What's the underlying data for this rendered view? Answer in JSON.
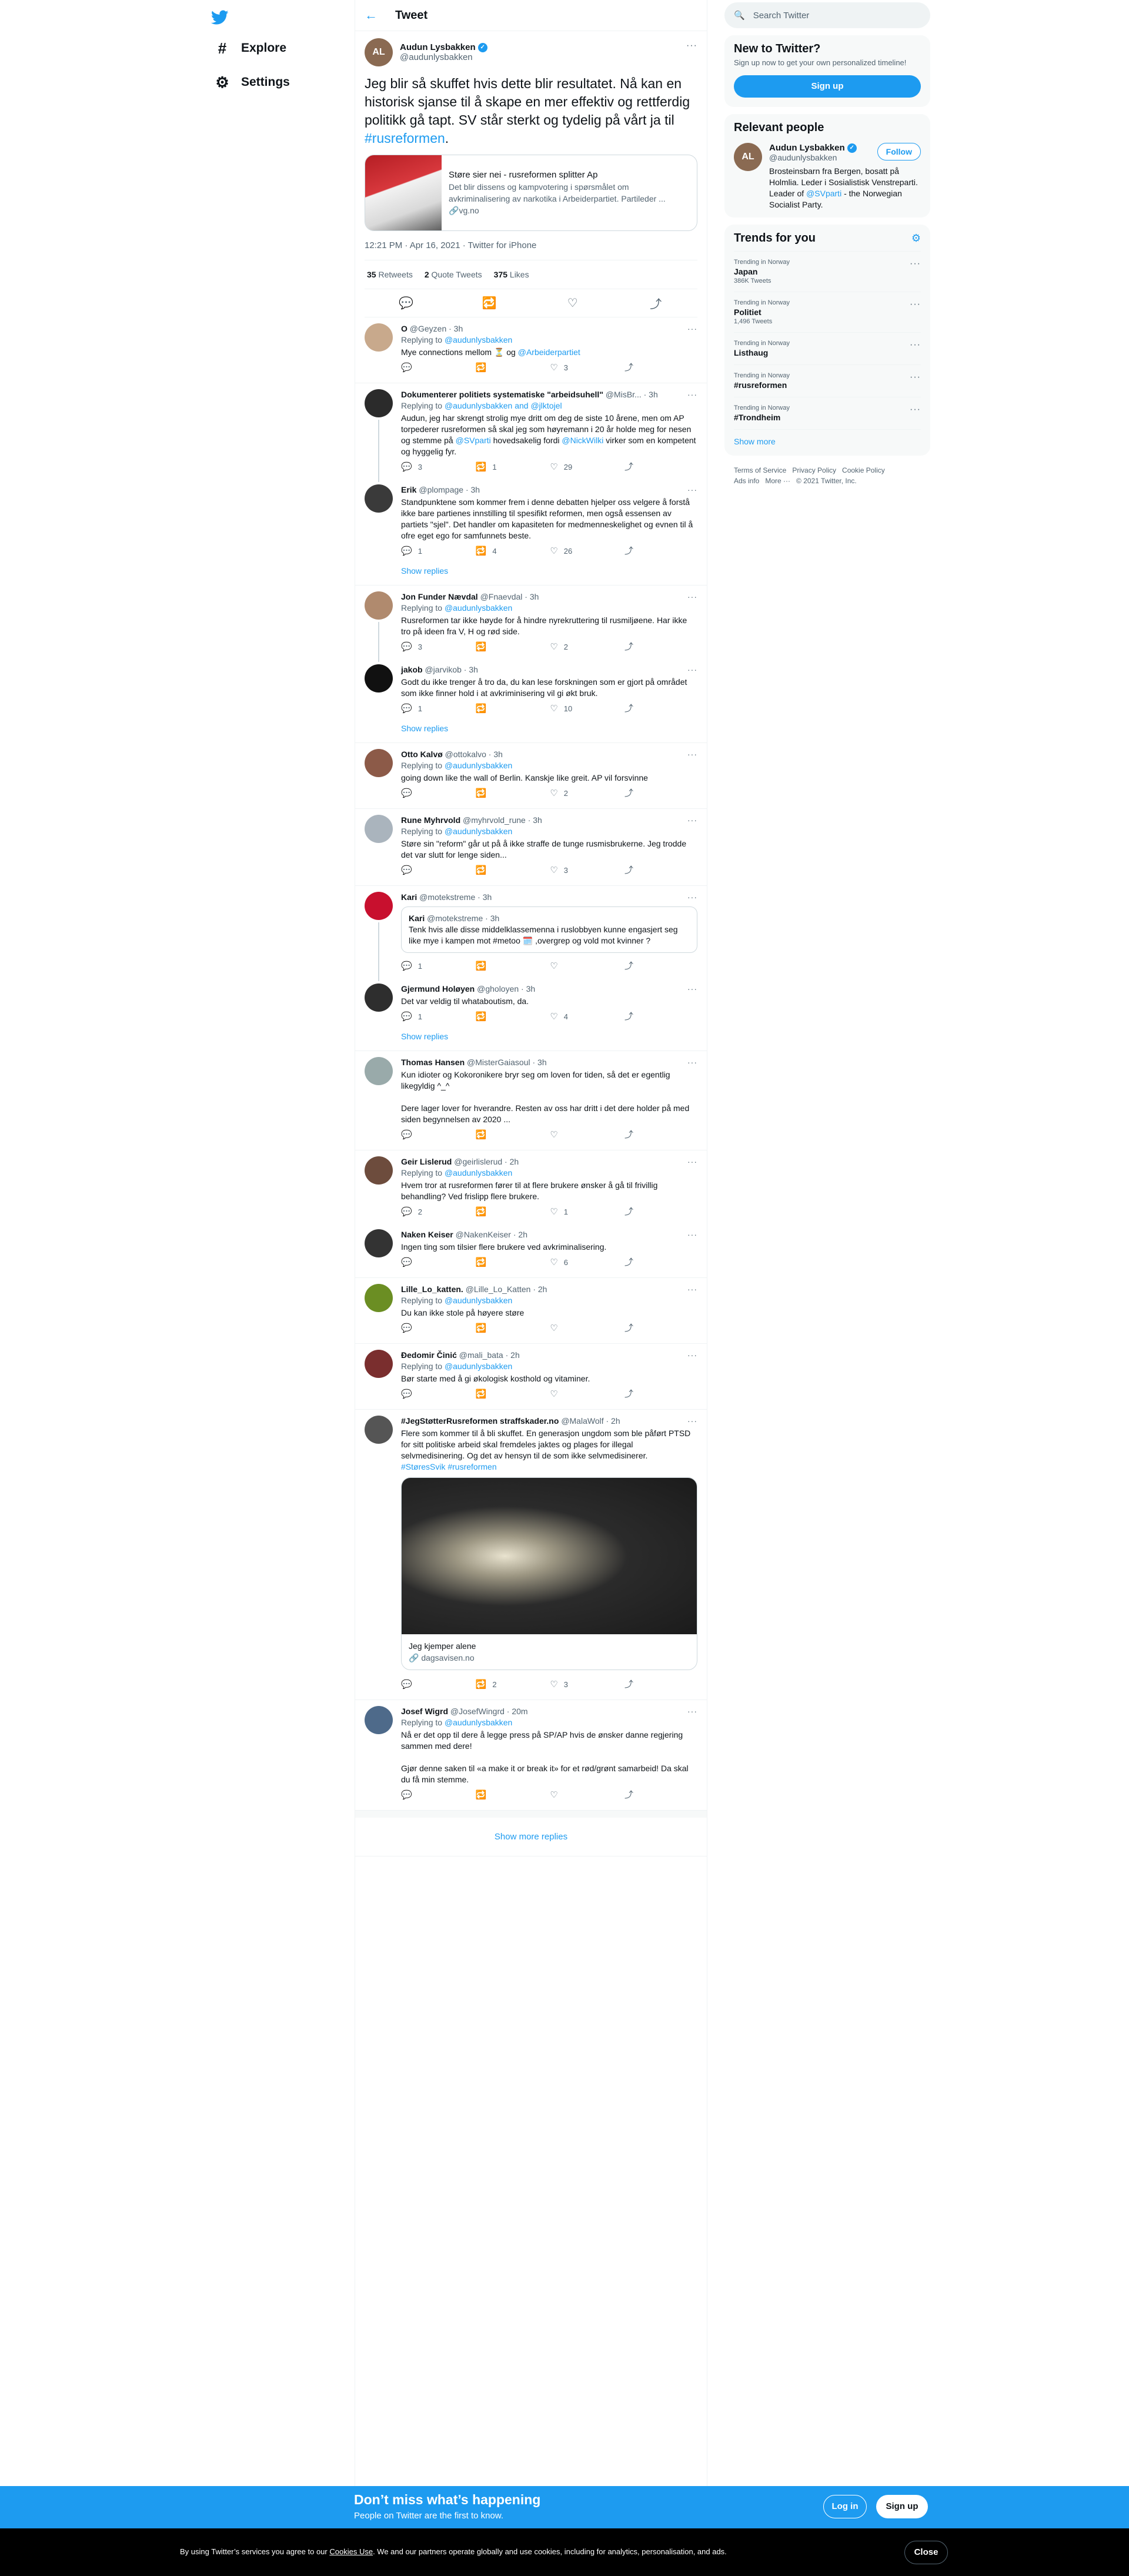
{
  "nav": {
    "items": [
      {
        "label": "Explore",
        "icon": "hashtag-icon"
      },
      {
        "label": "Settings",
        "icon": "gear-icon"
      }
    ]
  },
  "header": {
    "title": "Tweet"
  },
  "tweet": {
    "author_name": "Audun Lysbakken",
    "author_handle": "@audunlysbakken",
    "text_pre": "Jeg blir så skuffet hvis dette blir resultatet. Nå kan en historisk sjanse til å skape en mer effektiv og rettferdig politikk gå tapt. SV står sterkt og tydelig på vårt ja til ",
    "hashtag": "#rusreformen",
    "text_post": ".",
    "card_title": "Støre sier nei - rusreformen splitter Ap",
    "card_desc": "Det blir dissens og kampvotering i spørsmålet om avkriminalisering av narkotika i Arbeiderpartiet. Partileder ...",
    "card_domain": "vg.no",
    "time": "12:21 PM · Apr 16, 2021 · Twitter for iPhone",
    "retweets_count": "35",
    "retweets_label": "Retweets",
    "quotes_count": "2",
    "quotes_label": "Quote Tweets",
    "likes_count": "375",
    "likes_label": "Likes"
  },
  "replies": [
    {
      "name": "O",
      "handle": "@Geyzen · 3h",
      "to": "Replying to ",
      "to_link": "@audunlysbakken",
      "text": "Mye connections mellom ⏳ og ",
      "text_link": "@Arbeiderpartiet",
      "rep": "",
      "rt": "",
      "like": "3"
    },
    {
      "name": "Dokumenterer politiets systematiske \"arbeidsuhell\"",
      "handle": "@MisBr... · 3h",
      "to": "Replying to ",
      "to_link": "@audunlysbakken and @jlktojel",
      "text": "Audun, jeg har skrengt strolig mye dritt om deg de siste 10 årene, men om AP torpederer rusreformen så skal jeg som høyremann i 20 år holde meg for nesen og stemme på ",
      "text_link": "@SVparti",
      "text2": " hovedsakelig fordi ",
      "text_link2": "@NickWilki",
      "text3": " virker som en kompetent og hyggelig fyr.",
      "rep": "3",
      "rt": "1",
      "like": "29"
    },
    {
      "name": "Erik",
      "handle": "@plompage · 3h",
      "text": "Standpunktene som kommer frem i denne debatten hjelper oss velgere å forstå ikke bare partienes innstilling til spesifikt reformen, men også essensen av partiets \"sjel\". Det handler om kapasiteten for medmenneskelighet og evnen til å ofre eget ego for samfunnets beste.",
      "rep": "1",
      "rt": "4",
      "like": "26"
    },
    {
      "name": "Jon Funder Nævdal",
      "handle": "@Fnaevdal · 3h",
      "to": "Replying to ",
      "to_link": "@audunlysbakken",
      "text": "Rusreformen tar ikke høyde for å hindre nyrekruttering til rusmiljøene. Har ikke tro på ideen fra V, H og rød side.",
      "rep": "3",
      "rt": "",
      "like": "2"
    },
    {
      "name": "jakob",
      "handle": "@jarvikob · 3h",
      "text": "Godt du ikke trenger å tro da, du kan lese forskningen som er gjort på området som ikke finner hold i at avkriminisering vil gi økt bruk.",
      "rep": "1",
      "rt": "",
      "like": "10"
    },
    {
      "name": "Otto Kalvø",
      "handle": "@ottokalvo · 3h",
      "to": "Replying to ",
      "to_link": "@audunlysbakken",
      "text": "going down like the wall of Berlin.  Kanskje like greit.  AP vil forsvinne",
      "rep": "",
      "rt": "",
      "like": "2"
    },
    {
      "name": "Rune Myhrvold",
      "handle": "@myhrvold_rune · 3h",
      "to": "Replying to ",
      "to_link": "@audunlysbakken",
      "text": "Støre sin \"reform\" går ut på å ikke straffe de tunge rusmisbrukerne. Jeg trodde det var slutt for lenge siden...",
      "rep": "",
      "rt": "",
      "like": "3"
    },
    {
      "name": "Kari",
      "handle": "@motekstreme · 3h",
      "q_name": "Kari",
      "q_handle": "@motekstreme · 3h",
      "q_text": "Tenk hvis alle disse middelklassemenna i ruslobbyen kunne engasjert seg like mye i kampen mot #metoo 🗓️ ,overgrep og vold mot kvinner ?",
      "rep": "1",
      "rt": "",
      "like": ""
    },
    {
      "name": "Gjermund Holøyen",
      "handle": "@gholoyen · 3h",
      "text": "Det var veldig til whataboutism, da.",
      "rep": "1",
      "rt": "",
      "like": "4"
    },
    {
      "name": "Thomas Hansen",
      "handle": "@MisterGaiasoul · 3h",
      "text": "Kun idioter og Kokoronikere bryr seg om loven for tiden, så det er egentlig likegyldig ^_^",
      "text2": "Dere lager lover for hverandre. Resten av oss har dritt i det dere holder på med siden begynnelsen av 2020 ...",
      "rep": "",
      "rt": "",
      "like": ""
    },
    {
      "name": "Geir Lislerud",
      "handle": "@geirlislerud · 2h",
      "to": "Replying to ",
      "to_link": "@audunlysbakken",
      "text": "Hvem tror at rusreformen fører til at flere brukere ønsker å gå til frivillig behandling? Ved frislipp flere brukere.",
      "rep": "2",
      "rt": "",
      "like": "1"
    },
    {
      "name": "Naken Keiser",
      "handle": "@NakenKeiser · 2h",
      "text": "Ingen ting som tilsier flere brukere ved avkriminalisering.",
      "rep": "",
      "rt": "",
      "like": "6"
    },
    {
      "name": "Lille_Lo_katten.",
      "handle": "@Lille_Lo_Katten · 2h",
      "to": "Replying to ",
      "to_link": "@audunlysbakken",
      "text": "Du kan ikke stole på høyere støre",
      "rep": "",
      "rt": "",
      "like": ""
    },
    {
      "name": "Đedomir Činić",
      "handle": "@mali_bata · 2h",
      "to": "Replying to ",
      "to_link": "@audunlysbakken",
      "text": "Bør starte med å gi økologisk kosthold og vitaminer.",
      "rep": "",
      "rt": "",
      "like": ""
    },
    {
      "name": "#JegStøtterRusreformen straffskader.no",
      "handle": "@MalaWolf · 2h",
      "text": "Flere som kommer til å bli skuffet. En generasjon ungdom som ble påført PTSD for sitt politiske arbeid skal fremdeles jaktes og plages for illegal selvmedisinering. Og det av hensyn til de som ikke selvmedisinerer.",
      "text_link": "#StøresSvik #rusreformen",
      "media_title": "Jeg kjemper alene",
      "media_domain": "dagsavisen.no",
      "rep": "",
      "rt": "2",
      "like": "3"
    },
    {
      "name": "Josef Wigrd",
      "handle": "@JosefWingrd · 20m",
      "to": "Replying to ",
      "to_link": "@audunlysbakken",
      "text": "Nå er det opp til dere å legge press på SP/AP hvis de ønsker danne regjering sammen med dere!",
      "text2": "Gjør denne saken til «a make it or break it» for et rød/grønt samarbeid! Da skal du få min stemme.",
      "rep": "",
      "rt": "",
      "like": ""
    }
  ],
  "show_replies_label": "Show replies",
  "show_more_replies_label": "Show more replies",
  "sidebar": {
    "search_placeholder": "Search Twitter",
    "new_title": "New to Twitter?",
    "new_sub": "Sign up now to get your own personalized timeline!",
    "signup_label": "Sign up",
    "relevant_title": "Relevant people",
    "rp_name": "Audun Lysbakken",
    "rp_handle": "@audunlysbakken",
    "follow_label": "Follow",
    "rp_bio_pre": "Brosteinsbarn fra Bergen, bosatt på Holmlia. Leder i Sosialistisk Venstreparti. Leader of ",
    "rp_bio_link": "@SVparti",
    "rp_bio_post": " - the Norwegian Socialist Party.",
    "trends_title": "Trends for you",
    "trends": [
      {
        "context": "Trending in Norway",
        "name": "Japan",
        "count": "386K Tweets"
      },
      {
        "context": "Trending in Norway",
        "name": "Politiet",
        "count": "1,496 Tweets"
      },
      {
        "context": "Trending in Norway",
        "name": "Listhaug",
        "count": ""
      },
      {
        "context": "Trending in Norway",
        "name": "#rusreformen",
        "count": ""
      },
      {
        "context": "Trending in Norway",
        "name": "#Trondheim",
        "count": ""
      }
    ],
    "show_more_label": "Show more",
    "footer": [
      "Terms of Service",
      "Privacy Policy",
      "Cookie Policy",
      "Ads info",
      "More ···",
      "© 2021 Twitter, Inc."
    ]
  },
  "bottom_bar": {
    "title": "Don’t miss what’s happening",
    "sub": "People on Twitter are the first to know.",
    "login_label": "Log in",
    "signup_label": "Sign up"
  },
  "cookie": {
    "text_pre": "By using Twitter’s services you agree to our ",
    "link": "Cookies Use",
    "text_post": ". We and our partners operate globally and use cookies, including for analytics, personalisation, and ads.",
    "close_label": "Close"
  },
  "colors": {
    "accent": "#1d9bf0",
    "text": "#0f1419",
    "muted": "#536471",
    "bar": "#1d9bf0"
  }
}
